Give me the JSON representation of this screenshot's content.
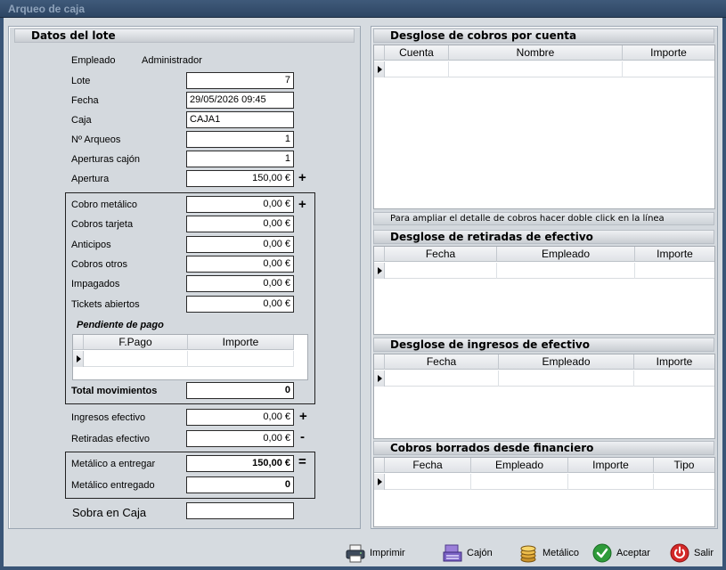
{
  "window": {
    "title": "Arqueo de caja"
  },
  "lote": {
    "header": "Datos del lote",
    "empleado_label": "Empleado",
    "empleado_value": "Administrador",
    "lote_label": "Lote",
    "lote_value": "7",
    "fecha_label": "Fecha",
    "fecha_value": "29/05/2026 09:45",
    "caja_label": "Caja",
    "caja_value": "CAJA1",
    "narqueos_label": "Nº Arqueos",
    "narqueos_value": "1",
    "aperturas_label": "Aperturas cajón",
    "aperturas_value": "1",
    "apertura_label": "Apertura",
    "apertura_value": "150,00 €",
    "cobro_metalico_label": "Cobro metálico",
    "cobro_metalico_value": "0,00 €",
    "cobros_tarjeta_label": "Cobros tarjeta",
    "cobros_tarjeta_value": "0,00 €",
    "anticipos_label": "Anticipos",
    "anticipos_value": "0,00 €",
    "cobros_otros_label": "Cobros otros",
    "cobros_otros_value": "0,00 €",
    "impagados_label": "Impagados",
    "impagados_value": "0,00 €",
    "tickets_label": "Tickets abiertos",
    "tickets_value": "0,00 €",
    "pendiente_label": "Pendiente de pago",
    "pendiente_cols": [
      "F.Pago",
      "Importe"
    ],
    "total_label": "Total movimientos",
    "total_value": "0",
    "ingresos_label": "Ingresos efectivo",
    "ingresos_value": "0,00 €",
    "retiradas_label": "Retiradas efectivo",
    "retiradas_value": "0,00 €",
    "metalico_entregar_label": "Metálico a entregar",
    "metalico_entregar_value": "150,00 €",
    "metalico_entregado_label": "Metálico entregado",
    "metalico_entregado_value": "0",
    "sobra_label": "Sobra en Caja",
    "sobra_value": "",
    "ops": {
      "plus": "+",
      "minus": "-",
      "equals": "="
    }
  },
  "desglose_cobros": {
    "header": "Desglose de cobros por cuenta",
    "cols": [
      "Cuenta",
      "Nombre",
      "Importe"
    ],
    "hint": "Para ampliar el detalle de cobros hacer doble click en la línea"
  },
  "desglose_retiradas": {
    "header": "Desglose de retiradas de efectivo",
    "cols": [
      "Fecha",
      "Empleado",
      "Importe"
    ]
  },
  "desglose_ingresos": {
    "header": "Desglose de ingresos de efectivo",
    "cols": [
      "Fecha",
      "Empleado",
      "Importe"
    ]
  },
  "cobros_borrados": {
    "header": "Cobros borrados desde financiero",
    "cols": [
      "Fecha",
      "Empleado",
      "Importe",
      "Tipo"
    ]
  },
  "buttons": {
    "imprimir": "Imprimir",
    "cajon": "Cajón",
    "metalico": "Metálico",
    "aceptar": "Aceptar",
    "salir": "Salir"
  },
  "colors": {
    "aceptar": "#2e9b3a",
    "salir": "#d42828",
    "titlebar": "#2d4563"
  }
}
